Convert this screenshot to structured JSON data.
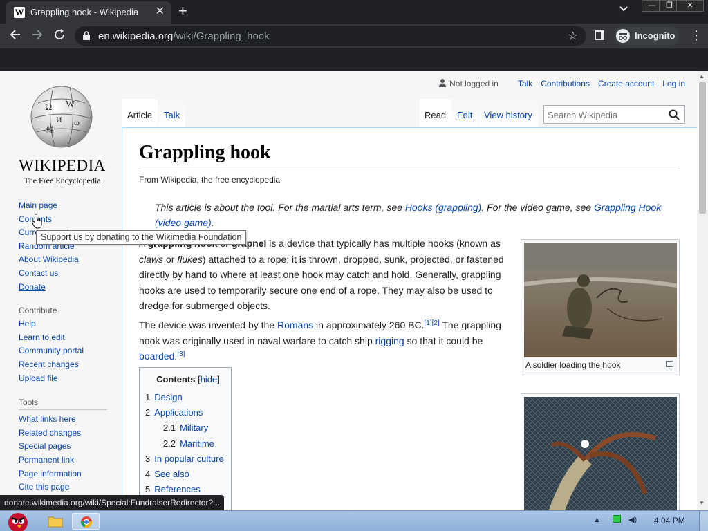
{
  "browser": {
    "tab_title": "Grappling hook - Wikipedia",
    "favicon_letter": "W",
    "url_host": "en.wikipedia.org",
    "url_path": "/wiki/Grappling_hook",
    "profile_label": "Incognito",
    "status_url": "donate.wikimedia.org/wiki/Special:FundraiserRedirector?..."
  },
  "logo": {
    "wordmark": "WIKIPEDIA",
    "tagline": "The Free Encyclopedia"
  },
  "personal": {
    "user": "Not logged in",
    "links": [
      "Talk",
      "Contributions",
      "Create account",
      "Log in"
    ]
  },
  "sidebar": {
    "main": [
      "Main page",
      "Contents",
      "Current events",
      "Random article",
      "About Wikipedia",
      "Contact us",
      "Donate"
    ],
    "contribute_heading": "Contribute",
    "contribute": [
      "Help",
      "Learn to edit",
      "Community portal",
      "Recent changes",
      "Upload file"
    ],
    "tools_heading": "Tools",
    "tools": [
      "What links here",
      "Related changes",
      "Special pages",
      "Permanent link",
      "Page information",
      "Cite this page"
    ]
  },
  "tooltip": "Support us by donating to the Wikimedia Foundation",
  "page_tabs": {
    "article": "Article",
    "talk": "Talk",
    "read": "Read",
    "edit": "Edit",
    "history": "View history"
  },
  "search": {
    "placeholder": "Search Wikipedia"
  },
  "article": {
    "title": "Grappling hook",
    "tagline": "From Wikipedia, the free encyclopedia",
    "hatnote": {
      "pre": "This article is about the tool. For the martial arts term, see ",
      "link1": "Hooks (grappling)",
      "mid": ". For the video game, see ",
      "link2": "Grappling Hook (video game)",
      "post": "."
    },
    "para1": {
      "a": "A ",
      "b1": "grappling hook",
      "c": " or ",
      "b2": "grapnel",
      "d": " is a device that typically has multiple hooks (known as ",
      "i1": "claws",
      "e": " or ",
      "i2": "flukes",
      "f": ") attached to a rope; it is thrown, dropped, sunk, projected, or fastened directly by hand to where at least one hook may catch and hold. Generally, grappling hooks are used to temporarily secure one end of a rope. They may also be used to dredge for submerged objects."
    },
    "para2": {
      "a": "The device was invented by the ",
      "link1": "Romans",
      "b": " in approximately 260 BC.",
      "ref1": "[1]",
      "ref2": "[2]",
      "c": " The grappling hook was originally used in naval warfare to catch ship ",
      "link2": "rigging",
      "d": " so that it could be ",
      "link3": "boarded",
      "e": ".",
      "ref3": "[3]"
    },
    "figure1_caption": "A soldier loading the hook"
  },
  "toc": {
    "title": "Contents",
    "hide": "hide",
    "items": [
      {
        "num": "1",
        "label": "Design"
      },
      {
        "num": "2",
        "label": "Applications"
      },
      {
        "num": "2.1",
        "label": "Military"
      },
      {
        "num": "2.2",
        "label": "Maritime"
      },
      {
        "num": "3",
        "label": "In popular culture"
      },
      {
        "num": "4",
        "label": "See also"
      },
      {
        "num": "5",
        "label": "References"
      }
    ]
  },
  "taskbar": {
    "clock": "4:04 PM"
  },
  "colors": {
    "link": "#0645ad",
    "chrome_bg": "#202124",
    "toolbar_bg": "#35363a"
  },
  "icons": [
    "wikipedia-favicon-icon",
    "close-icon",
    "plus-icon",
    "chevron-down-icon",
    "back-arrow-icon",
    "forward-arrow-icon",
    "reload-icon",
    "lock-icon",
    "star-icon",
    "side-panel-icon",
    "incognito-icon",
    "kebab-menu-icon",
    "user-icon",
    "search-icon",
    "magnify-icon",
    "cursor-hand-icon",
    "angry-bird-icon",
    "folder-icon",
    "chrome-icon",
    "network-icon",
    "volume-icon"
  ]
}
